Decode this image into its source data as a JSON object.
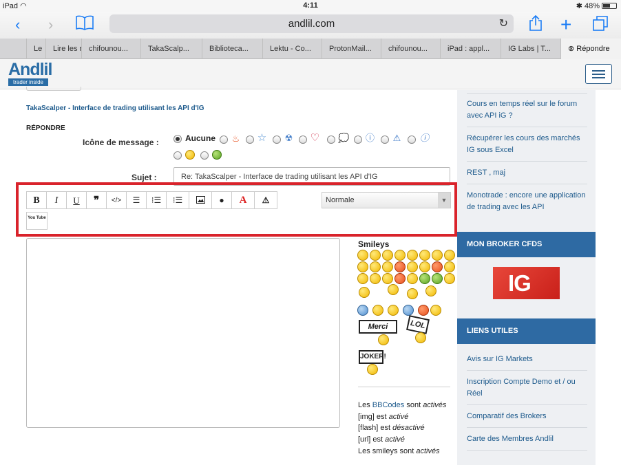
{
  "status_bar": {
    "device": "iPad",
    "time": "4:11",
    "battery": "48%"
  },
  "browser": {
    "url": "andlil.com",
    "tabs": [
      "Le",
      "Lire les r",
      "chifounou...",
      "TakaScalp...",
      "Biblioteca...",
      "Lektu - Co...",
      "ProtonMail...",
      "chifounou...",
      "iPad : appl...",
      "IG Labs | T...",
      "Répondre"
    ]
  },
  "site": {
    "logo_word": "Andlil",
    "logo_tagline": "trader inside"
  },
  "post": {
    "breadcrumb": "TakaScalper - Interface de trading utilisant les API d'IG",
    "reply_heading": "RÉPONDRE",
    "icon_label": "Icône de message :",
    "icon_none": "Aucune",
    "subject_label": "Sujet :",
    "subject_value": "Re: TakaScalper - Interface de trading utilisant les API d'IG",
    "toolbar_buttons": [
      "B",
      "I",
      "U",
      "quote",
      "code",
      "list",
      "list-bullets",
      "list-items",
      "image",
      "url",
      "color",
      "warning"
    ],
    "youtube_label": "You Tube",
    "font_size_value": "Normale",
    "smileys_heading": "Smileys",
    "sign_merci": "Merci",
    "sign_lol": "LOL",
    "sign_joker": "JOKER!",
    "bbcode": {
      "line1_prefix": "Les ",
      "line1_link": "BBCodes",
      "line1_mid": " sont ",
      "line1_state": "activés",
      "line2_prefix": "[img] est ",
      "line2_state": "activé",
      "line3_prefix": "[flash] est ",
      "line3_state": "désactivé",
      "line4_prefix": "[url] est ",
      "line4_state": "activé",
      "line5_prefix": "Les smileys sont ",
      "line5_state": "activés"
    }
  },
  "sidebar": {
    "recent_links": [
      "Cours en temps réel sur le forum avec API iG ?",
      "Récupérer les cours des marchés IG sous Excel",
      "REST , maj",
      "Monotrade : encore une application de trading avec les API"
    ],
    "broker_heading": "MON BROKER CFDS",
    "broker_logo": "IG",
    "links_heading": "LIENS UTILES",
    "useful_links": [
      "Avis sur IG Markets",
      "Inscription Compte Demo et / ou Réel",
      "Comparatif des Brokers",
      "Carte des Membres Andlil"
    ]
  },
  "colors": {
    "accent": "#2e6aa3",
    "highlight": "#d9232b",
    "link": "#1d5a8c"
  }
}
